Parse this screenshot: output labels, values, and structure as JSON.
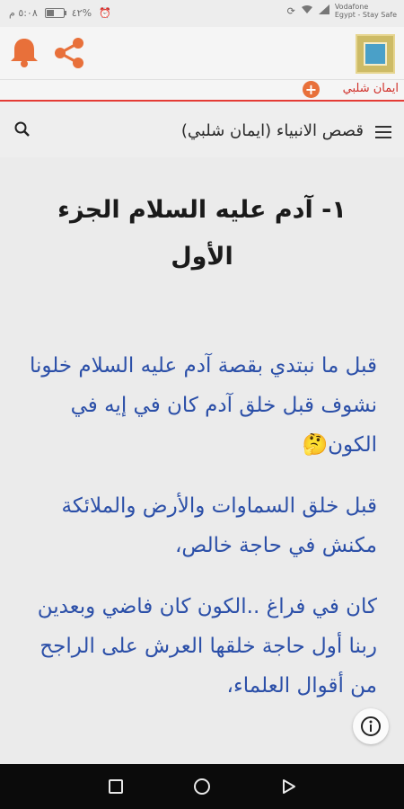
{
  "status_bar": {
    "carrier_line1": "Vodafone",
    "carrier_line2": "Egypt - Stay Safe",
    "battery_text": "٤٢%",
    "time": "٥:٠٨ م",
    "battery_level": 0.42
  },
  "top_bar": {
    "icons": [
      "bell-icon",
      "share-icon",
      "app-logo"
    ],
    "accent_color": "#e8703a"
  },
  "author_bar": {
    "author_name": "ايمان شلبي",
    "add_symbol": "+"
  },
  "app_bar": {
    "title": "قصص الانبياء (ايمان شلبي)"
  },
  "content": {
    "chapter_title": "١- آدم عليه السلام الجزء الأول",
    "paragraphs": [
      "قبل ما نبتدي بقصة آدم عليه السلام خلونا نشوف قبل خلق آدم كان في إيه في الكون🤔",
      "قبل خلق السماوات والأرض والملائكة مكنش في حاجة خالص،",
      "كان في فراغ ..الكون كان فاضي وبعدين ربنا أول حاجة خلقها العرش على الراجح من أقوال العلماء،"
    ],
    "text_color": "#2b4fa8"
  }
}
